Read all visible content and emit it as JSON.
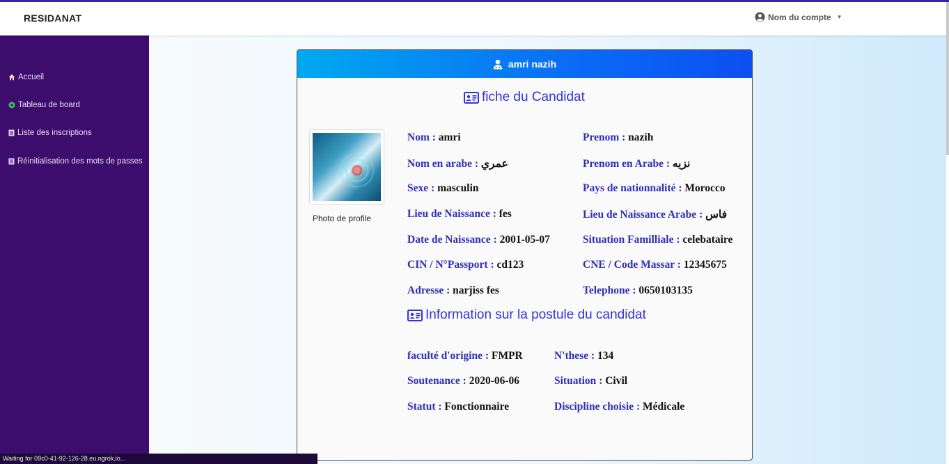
{
  "app": {
    "brand": "RESIDANAT",
    "account_label": "Nom du compte"
  },
  "colors": {
    "sidebar": "#3c0d6c",
    "header_start": "#00a9ef",
    "header_end": "#0c4ff2",
    "label": "#2f2fb8",
    "title": "#3232d9"
  },
  "sidebar": {
    "items": [
      {
        "label": "Accueil",
        "icon": "home-icon"
      },
      {
        "label": "Tableau de board",
        "icon": "dashboard-icon"
      },
      {
        "label": "Liste des inscriptions",
        "icon": "list-icon"
      },
      {
        "label": "Réinitialisation des mots de passes",
        "icon": "list-icon"
      }
    ]
  },
  "card": {
    "candidate_name": "amri nazih",
    "title": "fiche du Candidat",
    "photo_caption": "Photo de profile",
    "section2_title": "Information sur la postule du candidat",
    "fields_left": [
      {
        "label": "Nom",
        "value": "amri"
      },
      {
        "label": "Nom en arabe",
        "value": "عمري"
      },
      {
        "label": "Sexe",
        "value": "masculin"
      },
      {
        "label": "Lieu de Naissance",
        "value": "fes"
      },
      {
        "label": "Date de Naissance",
        "value": "2001-05-07"
      },
      {
        "label": "CIN / N°Passport",
        "value": "cd123"
      },
      {
        "label": "Adresse",
        "value": "narjiss fes"
      }
    ],
    "fields_right": [
      {
        "label": "Prenom",
        "value": "nazih"
      },
      {
        "label": "Prenom en Arabe",
        "value": "نزيه"
      },
      {
        "label": "Pays de nationnalité",
        "value": "Morocco"
      },
      {
        "label": "Lieu de Naissance Arabe",
        "value": "فاس"
      },
      {
        "label": "Situation Familliale",
        "value": "celebataire"
      },
      {
        "label": "CNE / Code Massar",
        "value": "12345675"
      },
      {
        "label": "Telephone",
        "value": "0650103135"
      }
    ],
    "postule_left": [
      {
        "label": "faculté d'origine",
        "value": "FMPR"
      },
      {
        "label": "Soutenance",
        "value": "2020-06-06"
      },
      {
        "label": "Statut",
        "value": "Fonctionnaire"
      }
    ],
    "postule_right": [
      {
        "label": "N'these",
        "value": "134"
      },
      {
        "label": "Situation",
        "value": "Civil"
      },
      {
        "label": "Discipline choisie",
        "value": "Médicale"
      }
    ]
  },
  "status_bar": {
    "text": "Waiting for 09c0-41-92-126-28.eu.ngrok.io..."
  }
}
